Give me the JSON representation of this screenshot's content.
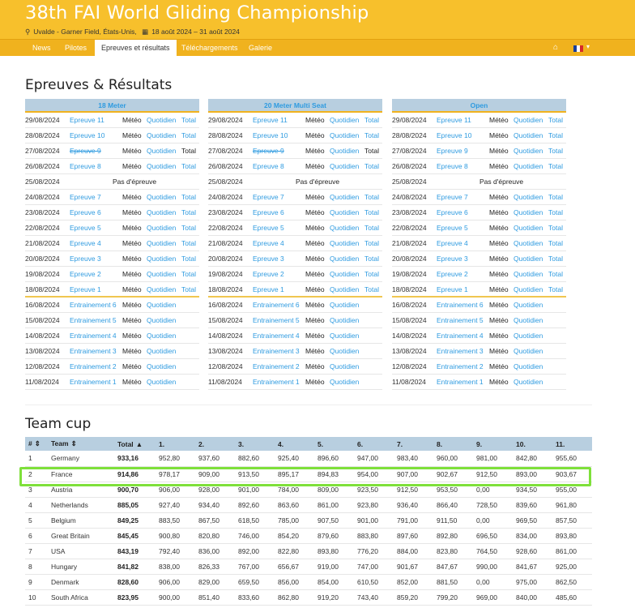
{
  "header": {
    "title": "38th FAI World Gliding Championship",
    "location": "Uvalde - Garner Field, États-Unis,",
    "dates": "18 août 2024 – 31 août 2024",
    "flag_colors": [
      "#1a3f9a",
      "#ffffff",
      "#d62b2b"
    ]
  },
  "nav": {
    "items": [
      "News",
      "Pilotes",
      "Epreuves et résultats",
      "Téléchargements",
      "Galerie"
    ],
    "active": "Epreuves et résultats"
  },
  "epreuves": {
    "title": "Epreuves & Résultats",
    "met_label": "Météo",
    "quot_label": "Quotidien",
    "total_label": "Total",
    "none_label": "Pas d'épreuve",
    "panels": [
      {
        "name": "18 Meter",
        "rows": [
          {
            "date": "29/08/2024",
            "event": "Epreuve 11"
          },
          {
            "date": "28/08/2024",
            "event": "Epreuve 10"
          },
          {
            "date": "27/08/2024",
            "event": "Epreuve 9",
            "cancelled": true
          },
          {
            "date": "26/08/2024",
            "event": "Epreuve 8"
          },
          {
            "date": "25/08/2024",
            "none": true
          },
          {
            "date": "24/08/2024",
            "event": "Epreuve 7"
          },
          {
            "date": "23/08/2024",
            "event": "Epreuve 6"
          },
          {
            "date": "22/08/2024",
            "event": "Epreuve 5"
          },
          {
            "date": "21/08/2024",
            "event": "Epreuve 4"
          },
          {
            "date": "20/08/2024",
            "event": "Epreuve 3"
          },
          {
            "date": "19/08/2024",
            "event": "Epreuve 2"
          },
          {
            "date": "18/08/2024",
            "event": "Epreuve 1"
          },
          {
            "date": "16/08/2024",
            "event": "Entrainement 6",
            "training": true
          },
          {
            "date": "15/08/2024",
            "event": "Entrainement 5",
            "training": true
          },
          {
            "date": "14/08/2024",
            "event": "Entrainement 4",
            "training": true
          },
          {
            "date": "13/08/2024",
            "event": "Entrainement 3",
            "training": true
          },
          {
            "date": "12/08/2024",
            "event": "Entrainement 2",
            "training": true
          },
          {
            "date": "11/08/2024",
            "event": "Entrainement 1",
            "training": true
          }
        ]
      },
      {
        "name": "20 Meter Multi Seat",
        "rows": [
          {
            "date": "29/08/2024",
            "event": "Epreuve 11"
          },
          {
            "date": "28/08/2024",
            "event": "Epreuve 10"
          },
          {
            "date": "27/08/2024",
            "event": "Epreuve 9",
            "cancelled": true
          },
          {
            "date": "26/08/2024",
            "event": "Epreuve 8"
          },
          {
            "date": "25/08/2024",
            "none": true
          },
          {
            "date": "24/08/2024",
            "event": "Epreuve 7"
          },
          {
            "date": "23/08/2024",
            "event": "Epreuve 6"
          },
          {
            "date": "22/08/2024",
            "event": "Epreuve 5"
          },
          {
            "date": "21/08/2024",
            "event": "Epreuve 4"
          },
          {
            "date": "20/08/2024",
            "event": "Epreuve 3"
          },
          {
            "date": "19/08/2024",
            "event": "Epreuve 2"
          },
          {
            "date": "18/08/2024",
            "event": "Epreuve 1"
          },
          {
            "date": "16/08/2024",
            "event": "Entrainement 6",
            "training": true
          },
          {
            "date": "15/08/2024",
            "event": "Entrainement 5",
            "training": true
          },
          {
            "date": "14/08/2024",
            "event": "Entrainement 4",
            "training": true
          },
          {
            "date": "13/08/2024",
            "event": "Entrainement 3",
            "training": true
          },
          {
            "date": "12/08/2024",
            "event": "Entrainement 2",
            "training": true
          },
          {
            "date": "11/08/2024",
            "event": "Entrainement 1",
            "training": true
          }
        ]
      },
      {
        "name": "Open",
        "rows": [
          {
            "date": "29/08/2024",
            "event": "Epreuve 11"
          },
          {
            "date": "28/08/2024",
            "event": "Epreuve 10"
          },
          {
            "date": "27/08/2024",
            "event": "Epreuve 9"
          },
          {
            "date": "26/08/2024",
            "event": "Epreuve 8"
          },
          {
            "date": "25/08/2024",
            "none": true
          },
          {
            "date": "24/08/2024",
            "event": "Epreuve 7"
          },
          {
            "date": "23/08/2024",
            "event": "Epreuve 6"
          },
          {
            "date": "22/08/2024",
            "event": "Epreuve 5"
          },
          {
            "date": "21/08/2024",
            "event": "Epreuve 4"
          },
          {
            "date": "20/08/2024",
            "event": "Epreuve 3"
          },
          {
            "date": "19/08/2024",
            "event": "Epreuve 2"
          },
          {
            "date": "18/08/2024",
            "event": "Epreuve 1"
          },
          {
            "date": "16/08/2024",
            "event": "Entrainement 6",
            "training": true
          },
          {
            "date": "15/08/2024",
            "event": "Entrainement 5",
            "training": true
          },
          {
            "date": "14/08/2024",
            "event": "Entrainement 4",
            "training": true
          },
          {
            "date": "13/08/2024",
            "event": "Entrainement 3",
            "training": true
          },
          {
            "date": "12/08/2024",
            "event": "Entrainement 2",
            "training": true
          },
          {
            "date": "11/08/2024",
            "event": "Entrainement 1",
            "training": true
          }
        ]
      }
    ]
  },
  "teamcup": {
    "title": "Team cup",
    "columns": [
      "#",
      "Team",
      "Total",
      "1.",
      "2.",
      "3.",
      "4.",
      "5.",
      "6.",
      "7.",
      "8.",
      "9.",
      "10.",
      "11."
    ],
    "sort_icons": [
      "⇕",
      "⇕",
      "▲"
    ],
    "highlight_color": "#7ee03a",
    "rows": [
      [
        "1",
        "Germany",
        "933,16",
        "952,80",
        "937,60",
        "882,60",
        "925,40",
        "896,60",
        "947,00",
        "983,40",
        "960,00",
        "981,00",
        "842,80",
        "955,60"
      ],
      [
        "2",
        "France",
        "914,86",
        "978,17",
        "909,00",
        "913,50",
        "895,17",
        "894,83",
        "954,00",
        "907,00",
        "902,67",
        "912,50",
        "893,00",
        "903,67"
      ],
      [
        "3",
        "Austria",
        "900,70",
        "906,00",
        "928,00",
        "901,00",
        "784,00",
        "809,00",
        "923,50",
        "912,50",
        "953,50",
        "0,00",
        "934,50",
        "955,00"
      ],
      [
        "4",
        "Netherlands",
        "885,05",
        "927,40",
        "934,40",
        "892,60",
        "863,60",
        "861,00",
        "923,80",
        "936,40",
        "866,40",
        "728,50",
        "839,60",
        "961,80"
      ],
      [
        "5",
        "Belgium",
        "849,25",
        "883,50",
        "867,50",
        "618,50",
        "785,00",
        "907,50",
        "901,00",
        "791,00",
        "911,50",
        "0,00",
        "969,50",
        "857,50"
      ],
      [
        "6",
        "Great Britain",
        "845,45",
        "900,80",
        "820,80",
        "746,00",
        "854,20",
        "879,60",
        "883,80",
        "897,60",
        "892,80",
        "696,50",
        "834,00",
        "893,80"
      ],
      [
        "7",
        "USA",
        "843,19",
        "792,40",
        "836,00",
        "892,00",
        "822,80",
        "893,80",
        "776,20",
        "884,00",
        "823,80",
        "764,50",
        "928,60",
        "861,00"
      ],
      [
        "8",
        "Hungary",
        "841,82",
        "838,00",
        "826,33",
        "767,00",
        "656,67",
        "919,00",
        "747,00",
        "901,67",
        "847,67",
        "990,00",
        "841,67",
        "925,00"
      ],
      [
        "9",
        "Denmark",
        "828,60",
        "906,00",
        "829,00",
        "659,50",
        "856,00",
        "854,00",
        "610,50",
        "852,00",
        "881,50",
        "0,00",
        "975,00",
        "862,50"
      ],
      [
        "10",
        "South Africa",
        "823,95",
        "900,00",
        "851,40",
        "833,60",
        "862,80",
        "919,20",
        "743,40",
        "859,20",
        "799,20",
        "969,00",
        "840,00",
        "485,60"
      ]
    ]
  }
}
